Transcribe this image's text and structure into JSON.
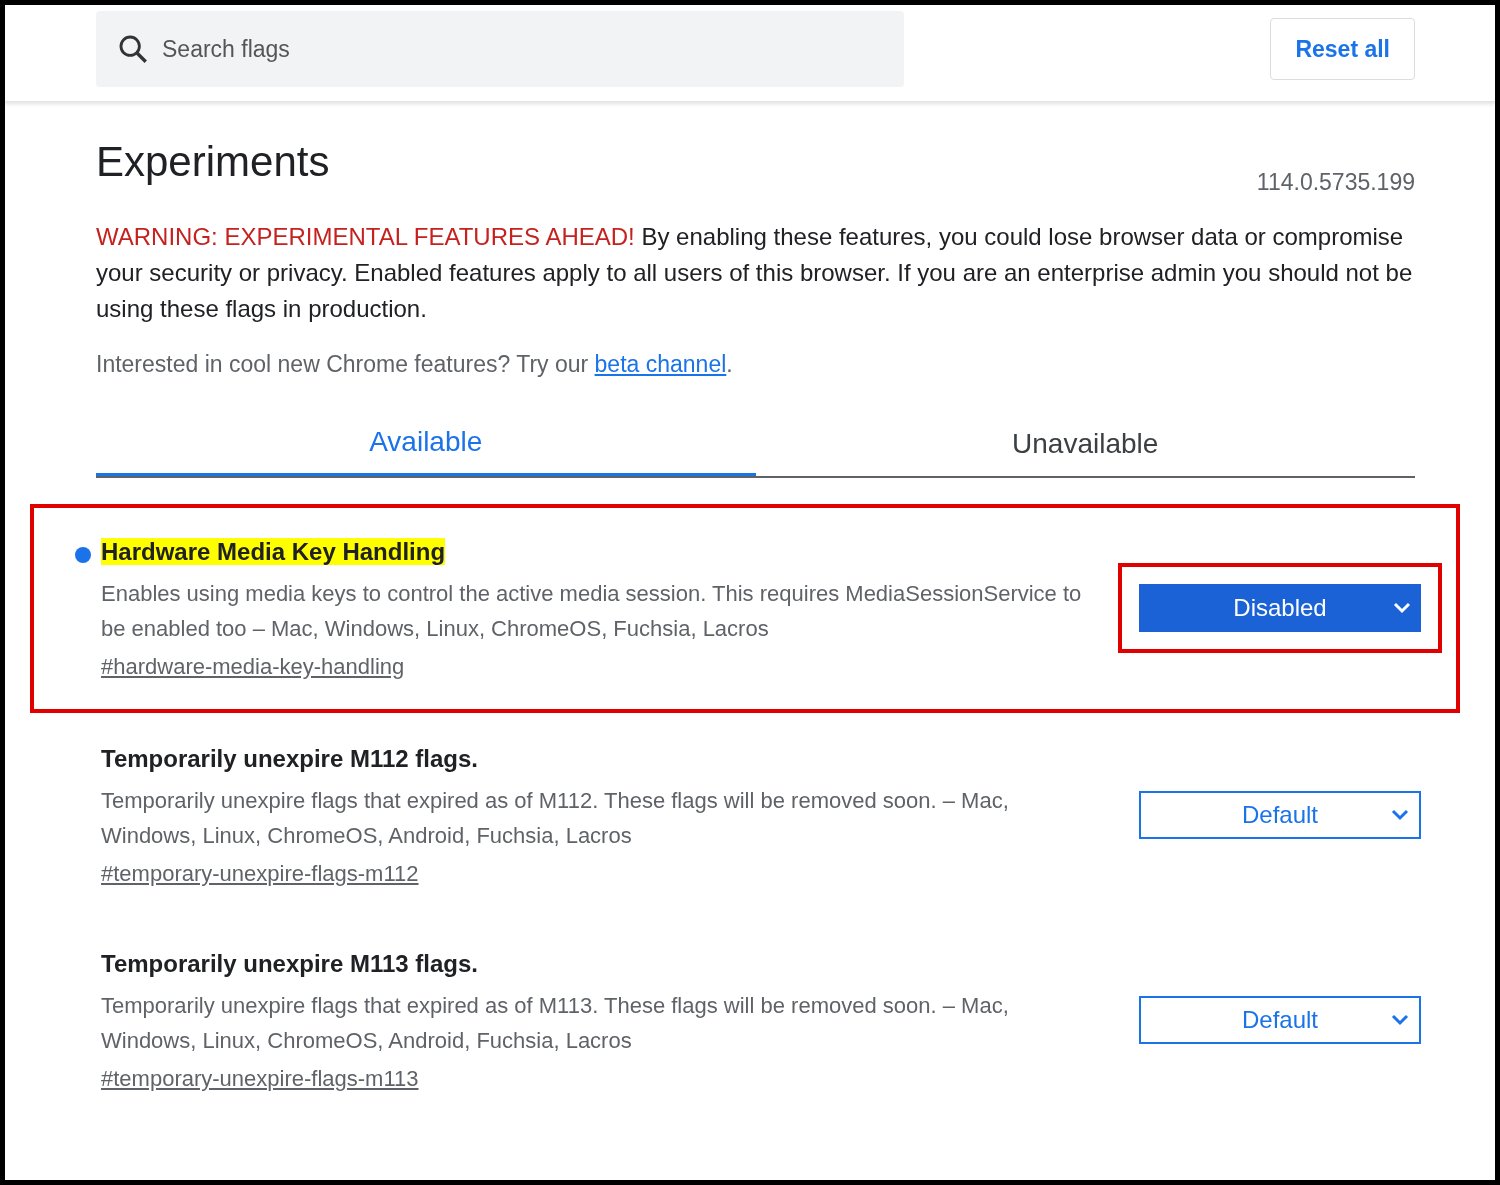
{
  "search": {
    "placeholder": "Search flags"
  },
  "reset_button": "Reset all",
  "title": "Experiments",
  "version": "114.0.5735.199",
  "warning": {
    "label": "WARNING: EXPERIMENTAL FEATURES AHEAD!",
    "text": " By enabling these features, you could lose browser data or compromise your security or privacy. Enabled features apply to all users of this browser. If you are an enterprise admin you should not be using these flags in production."
  },
  "beta": {
    "text": "Interested in cool new Chrome features? Try our ",
    "link": "beta channel",
    "after": "."
  },
  "tabs": [
    {
      "label": "Available",
      "selected": true
    },
    {
      "label": "Unavailable",
      "selected": false
    }
  ],
  "flags": [
    {
      "title": "Hardware Media Key Handling",
      "highlighted": true,
      "modified": true,
      "annotated": true,
      "description": "Enables using media keys to control the active media session. This requires MediaSessionService to be enabled too – Mac, Windows, Linux, ChromeOS, Fuchsia, Lacros",
      "link": "#hardware-media-key-handling",
      "value": "Disabled"
    },
    {
      "title": "Temporarily unexpire M112 flags.",
      "highlighted": false,
      "modified": false,
      "annotated": false,
      "description": "Temporarily unexpire flags that expired as of M112. These flags will be removed soon. – Mac, Windows, Linux, ChromeOS, Android, Fuchsia, Lacros",
      "link": "#temporary-unexpire-flags-m112",
      "value": "Default"
    },
    {
      "title": "Temporarily unexpire M113 flags.",
      "highlighted": false,
      "modified": false,
      "annotated": false,
      "description": "Temporarily unexpire flags that expired as of M113. These flags will be removed soon. – Mac, Windows, Linux, ChromeOS, Android, Fuchsia, Lacros",
      "link": "#temporary-unexpire-flags-m113",
      "value": "Default"
    }
  ]
}
